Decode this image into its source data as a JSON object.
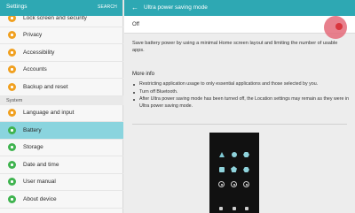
{
  "left": {
    "title": "Settings",
    "search_label": "SEARCH",
    "items_top": [
      {
        "label": "Lock screen and security",
        "color": "#f0a020",
        "icon": "lock-icon"
      },
      {
        "label": "Privacy",
        "color": "#f0a020",
        "icon": "privacy-icon"
      },
      {
        "label": "Accessibility",
        "color": "#f0a020",
        "icon": "accessibility-icon"
      },
      {
        "label": "Accounts",
        "color": "#f0a020",
        "icon": "accounts-icon"
      },
      {
        "label": "Backup and reset",
        "color": "#f0a020",
        "icon": "backup-icon"
      }
    ],
    "section": "System",
    "items_system": [
      {
        "label": "Language and input",
        "color": "#f0a020",
        "icon": "language-icon"
      },
      {
        "label": "Battery",
        "color": "#3fb34f",
        "icon": "battery-icon"
      },
      {
        "label": "Storage",
        "color": "#3fb34f",
        "icon": "storage-icon"
      },
      {
        "label": "Date and time",
        "color": "#3fb34f",
        "icon": "clock-icon"
      },
      {
        "label": "User manual",
        "color": "#3fb34f",
        "icon": "manual-icon"
      },
      {
        "label": "About device",
        "color": "#3fb34f",
        "icon": "info-icon"
      }
    ],
    "active": "Battery"
  },
  "right": {
    "title": "Ultra power saving mode",
    "toggle_label": "Off",
    "toggle_state": "off",
    "description": "Save battery power by using a minimal Home screen layout and limiting the number of usable apps.",
    "more_info_title": "More info",
    "info_items": [
      "Restricting application usage to only essential applications and those selected by you.",
      "Turn off Bluetooth.",
      "After Ultra power saving mode has been turned off, the Location settings may remain as they were in Ultra power saving mode."
    ]
  },
  "colors": {
    "header": "#2ea8b3",
    "active_item": "#8ad4de",
    "toggle_accent": "#d9353d"
  }
}
